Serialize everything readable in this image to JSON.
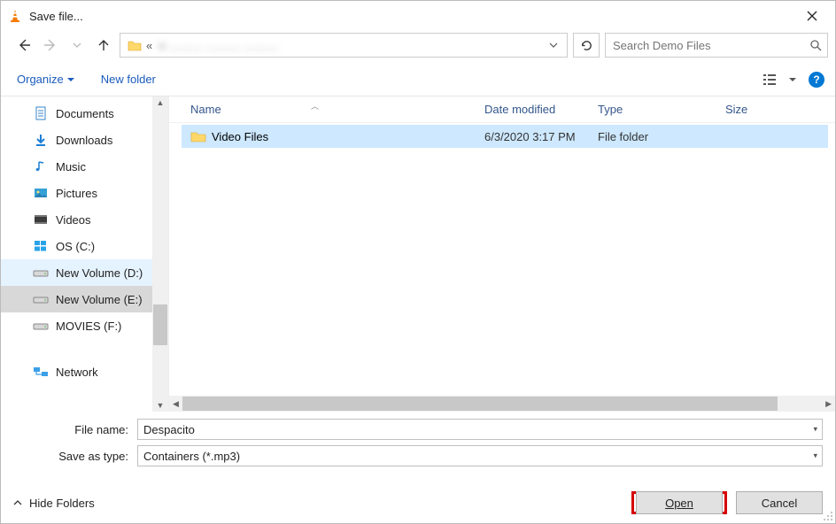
{
  "title": "Save file...",
  "breadcrumb_blurred": "«  ………  ………  ………",
  "search_placeholder": "Search Demo Files",
  "toolbar": {
    "organize": "Organize",
    "new_folder": "New folder"
  },
  "sidebar": {
    "items": [
      {
        "label": "Documents",
        "icon": "doc"
      },
      {
        "label": "Downloads",
        "icon": "down"
      },
      {
        "label": "Music",
        "icon": "music"
      },
      {
        "label": "Pictures",
        "icon": "pic"
      },
      {
        "label": "Videos",
        "icon": "vid"
      },
      {
        "label": "OS (C:)",
        "icon": "win"
      },
      {
        "label": "New Volume (D:)",
        "icon": "drive",
        "state": "hov"
      },
      {
        "label": "New Volume (E:)",
        "icon": "drive",
        "state": "sel"
      },
      {
        "label": "MOVIES (F:)",
        "icon": "drive"
      }
    ],
    "network": "Network"
  },
  "columns": {
    "name": "Name",
    "date": "Date modified",
    "type": "Type",
    "size": "Size"
  },
  "rows": [
    {
      "name": "Video Files",
      "date": "6/3/2020 3:17 PM",
      "type": "File folder",
      "size": ""
    }
  ],
  "file_name_label": "File name:",
  "file_name_value": "Despacito",
  "save_type_label": "Save as type:",
  "save_type_value": "Containers (*.mp3)",
  "hide_folders": "Hide Folders",
  "open_btn": "Open",
  "cancel_btn": "Cancel"
}
